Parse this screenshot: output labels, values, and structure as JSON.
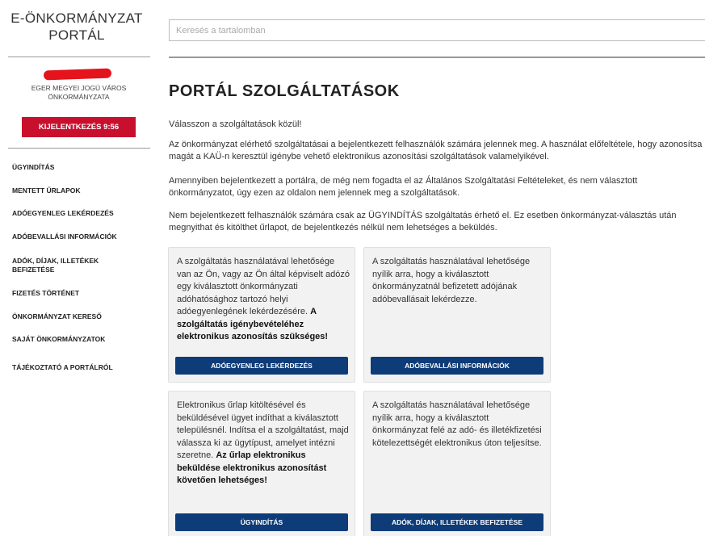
{
  "sidebar": {
    "logo_line1": "E-ÖNKORMÁNYZAT",
    "logo_line2": "PORTÁL",
    "city_line1": "EGER MEGYEI JOGÚ VÁROS",
    "city_line2": "ÖNKORMÁNYZATA",
    "logout_label": "KIJELENTKEZÉS 9:56",
    "redaction_color": "#e5131c",
    "nav_items": [
      "ÜGYINDÍTÁS",
      "MENTETT ŰRLAPOK",
      "ADÓEGYENLEG LEKÉRDEZÉS",
      "ADÓBEVALLÁSI INFORMÁCIÓK",
      "ADÓK, DÍJAK, ILLETÉKEK BEFIZETÉSE",
      "FIZETÉS TÖRTÉNET",
      "ÖNKORMÁNYZAT KERESŐ",
      "SAJÁT ÖNKORMÁNYZATOK",
      "TÁJÉKOZTATÓ A PORTÁLRÓL"
    ]
  },
  "search": {
    "placeholder": "Keresés a tartalomban",
    "value": ""
  },
  "main": {
    "title": "PORTÁL SZOLGÁLTATÁSOK",
    "paragraphs": [
      "Válasszon a szolgáltatások közül!",
      "Az önkormányzat elérhető szolgáltatásai a bejelentkezett felhasználók számára jelennek meg. A használat előfeltétele, hogy azonosítsa magát a KAÜ-n keresztül igénybe vehető elektronikus azonosítási szolgáltatások valamelyikével.",
      "Amennyiben bejelentkezett a portálra, de még nem fogadta el az Általános Szolgáltatási Feltételeket, és nem választott önkormányzatot, úgy ezen az oldalon nem jelennek meg a szolgáltatások.",
      "Nem bejelentkezett felhasználók számára csak az ÜGYINDÍTÁS szolgáltatás érhető el. Ez esetben önkormányzat-választás után megnyithat és kitölthet űrlapot, de bejelentkezés nélkül nem lehetséges a beküldés."
    ],
    "cards": [
      {
        "text": "A szolgáltatás használatával lehetősége van az Ön, vagy az Ön által képviselt adózó egy kiválasztott önkormányzati adóhatósághoz tartozó helyi adóegyenlegének lekérdezésére.",
        "bold": "A szolgáltatás igénybevételéhez elektronikus azonosítás szükséges!",
        "button": "ADÓEGYENLEG LEKÉRDEZÉS"
      },
      {
        "text": "A szolgáltatás használatával lehetősége nyílik arra, hogy a kiválasztott önkormányzatnál befizetett adójának adóbevallásait lekérdezze.",
        "bold": "",
        "button": "ADÓBEVALLÁSI INFORMÁCIÓK"
      },
      {
        "text": "Elektronikus űrlap kitöltésével és beküldésével ügyet indíthat a kiválasztott településnél. Indítsa el a szolgáltatást, majd válassza ki az ügytípust, amelyet intézni szeretne.",
        "bold": "Az űrlap elektronikus beküldése elektronikus azonosítást követően lehetséges!",
        "button": "ÜGYINDÍTÁS"
      },
      {
        "text": "A szolgáltatás használatával lehetősége nyílik arra, hogy a kiválasztott önkormányzat felé az adó- és illetékfizetési kötelezettségét elektronikus úton teljesítse.",
        "bold": "",
        "button": "ADÓK, DÍJAK, ILLETÉKEK BEFIZETÉSE"
      }
    ]
  },
  "colors": {
    "logout_bg": "#c8102e",
    "button_bg": "#0d3c78",
    "card_bg": "#f2f2f2"
  }
}
